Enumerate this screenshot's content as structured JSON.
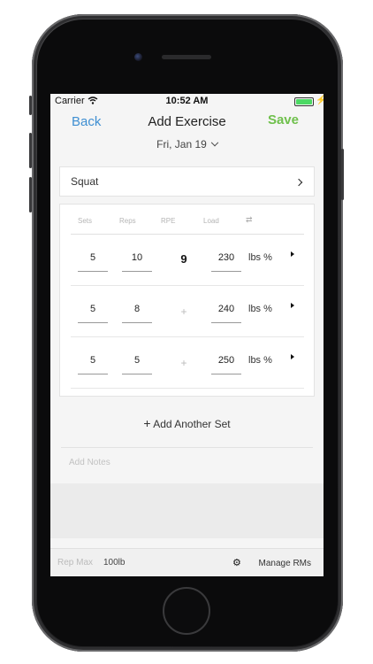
{
  "status": {
    "carrier": "Carrier",
    "time": "10:52 AM",
    "battery_level": 1.0
  },
  "nav": {
    "back_label": "Back",
    "title": "Add Exercise",
    "save_label": "Save"
  },
  "date": {
    "label": "Fri, Jan 19"
  },
  "exercise": {
    "name": "Squat"
  },
  "table": {
    "headers": [
      "Sets",
      "Reps",
      "RPE",
      "Load"
    ],
    "rows": [
      {
        "sets": "5",
        "reps": "10",
        "rpe": "9",
        "load": "230",
        "units": "lbs %"
      },
      {
        "sets": "5",
        "reps": "8",
        "rpe": "+",
        "load": "240",
        "units": "lbs %"
      },
      {
        "sets": "5",
        "reps": "5",
        "rpe": "+",
        "load": "250",
        "units": "lbs %"
      }
    ]
  },
  "actions": {
    "add_set_plus": "+",
    "add_set_label": "Add Another Set",
    "notes_placeholder": "Add Notes"
  },
  "footer": {
    "rep_max_label": "Rep Max",
    "rep_max_value": "100lb",
    "manage_label": "Manage RMs"
  },
  "colors": {
    "accent_blue": "#3f8fd2",
    "save_green": "#6fc04c",
    "battery_green": "#4cd964"
  },
  "icons": [
    "wifi-icon",
    "battery-icon",
    "chevron-down-icon",
    "chevron-right-icon",
    "swap-icon",
    "play-triangle-icon",
    "gear-icon"
  ]
}
